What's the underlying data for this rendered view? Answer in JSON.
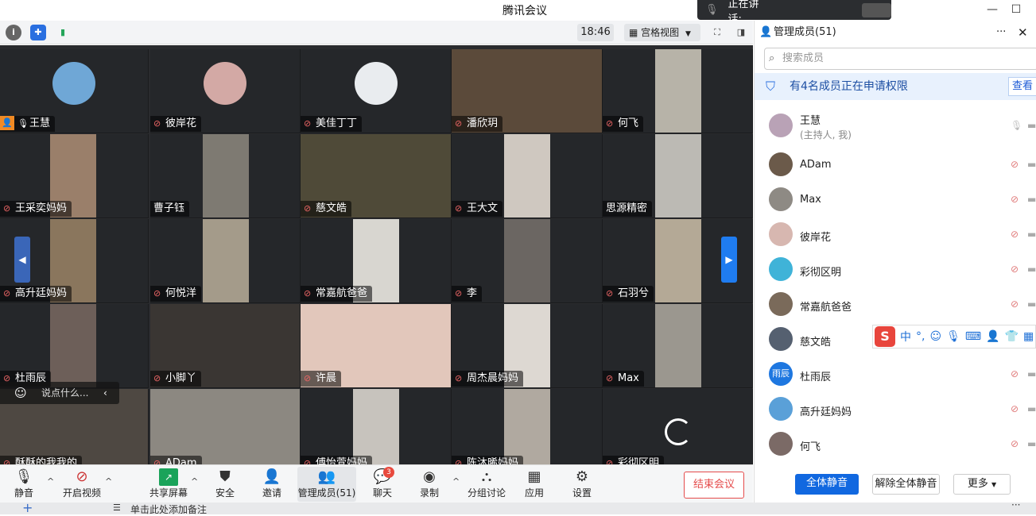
{
  "window": {
    "title": "腾讯会议",
    "speaking_label": "正在讲话:"
  },
  "toolbar": {
    "time": "18:46",
    "grid_view_label": "宫格视图"
  },
  "tiles": [
    {
      "name": "王慧"
    },
    {
      "name": "彼岸花"
    },
    {
      "name": "美佳丁丁"
    },
    {
      "name": "潘欣玥"
    },
    {
      "name": "何飞"
    },
    {
      "name": "王采奕妈妈"
    },
    {
      "name": "曹子钰"
    },
    {
      "name": "慈文皓"
    },
    {
      "name": "王大文"
    },
    {
      "name": "思源精密"
    },
    {
      "name": "高升廷妈妈"
    },
    {
      "name": "何悦洋"
    },
    {
      "name": "常嘉航爸爸"
    },
    {
      "name": "李"
    },
    {
      "name": "石羽兮"
    },
    {
      "name": "杜雨辰"
    },
    {
      "name": "小脚丫"
    },
    {
      "name": "许晨"
    },
    {
      "name": "周杰晨妈妈"
    },
    {
      "name": "Max"
    },
    {
      "name": "酥酥的我我的"
    },
    {
      "name": "ADam"
    },
    {
      "name": "傅怡萱妈妈"
    },
    {
      "name": "陈沐晞妈妈"
    },
    {
      "name": "彩彻区明"
    }
  ],
  "chat_popup": {
    "placeholder": "说点什么..."
  },
  "bottom_bar": {
    "mute": "静音",
    "video": "开启视频",
    "share": "共享屏幕",
    "security": "安全",
    "invite": "邀请",
    "members": "管理成员(51)",
    "chat": "聊天",
    "chat_badge": "3",
    "record": "录制",
    "breakout": "分组讨论",
    "apps": "应用",
    "settings": "设置",
    "end": "结束会议"
  },
  "note_bar": {
    "text": "单击此处添加备注"
  },
  "panel": {
    "title": "管理成员(51)",
    "search_placeholder": "搜索成员",
    "permission_notice": "有4名成员正在申请权限",
    "permission_view": "查看",
    "members": [
      {
        "name": "王慧",
        "sub": "(主持人, 我)"
      },
      {
        "name": "ADam"
      },
      {
        "name": "Max"
      },
      {
        "name": "彼岸花"
      },
      {
        "name": "彩彻区明"
      },
      {
        "name": "常嘉航爸爸"
      },
      {
        "name": "慈文皓"
      },
      {
        "name": "杜雨辰",
        "avatar_text": "雨辰"
      },
      {
        "name": "高升廷妈妈"
      },
      {
        "name": "何飞"
      }
    ],
    "mute_all": "全体静音",
    "unmute_all": "解除全体静音",
    "more": "更多"
  },
  "ime": {
    "zh": "中"
  }
}
